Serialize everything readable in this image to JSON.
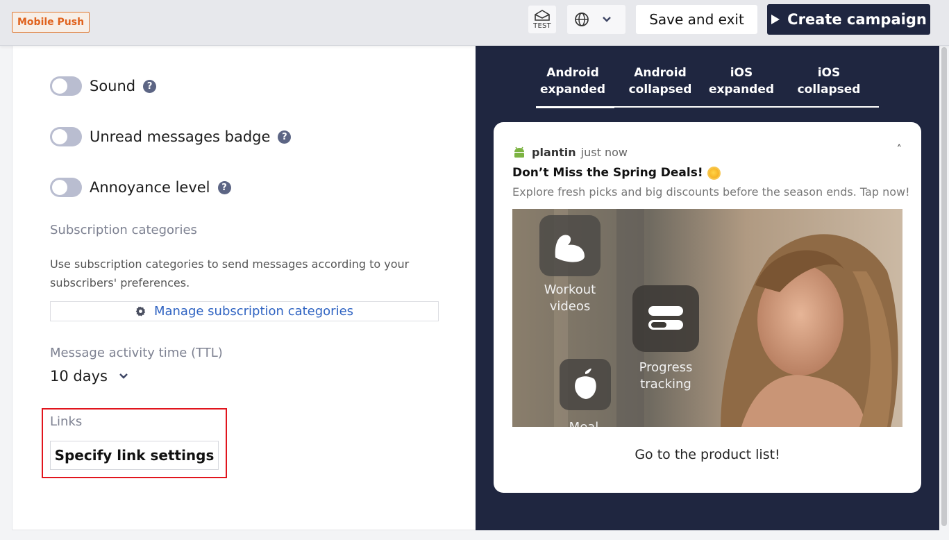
{
  "header": {
    "channel_badge": "Mobile Push",
    "test_label": "TEST",
    "save_label": "Save and exit",
    "create_label": "Create campaign"
  },
  "settings": {
    "toggles": [
      {
        "label": "Sound",
        "on": false
      },
      {
        "label": "Unread messages badge",
        "on": false
      },
      {
        "label": "Annoyance level",
        "on": false
      }
    ],
    "subscription_title": "Subscription categories",
    "subscription_desc": "Use subscription categories to send messages according to your subscribers' preferences.",
    "manage_label": "Manage subscription categories",
    "ttl_label": "Message activity time (TTL)",
    "ttl_value": "10 days",
    "links_label": "Links",
    "link_button": "Specify link settings"
  },
  "preview": {
    "tabs": [
      {
        "label": "Android expanded",
        "active": true
      },
      {
        "label": "Android collapsed",
        "active": false
      },
      {
        "label": "iOS expanded",
        "active": false
      },
      {
        "label": "iOS collapsed",
        "active": false
      }
    ],
    "app_name": "plantin",
    "time": "just now",
    "title": "Don’t Miss the Spring Deals!",
    "body": "Explore fresh picks and big discounts before the season ends. Tap now!",
    "image_labels": [
      "Workout videos",
      "Progress tracking",
      "Meal plans"
    ],
    "action_text": "Go to the product list!"
  },
  "colors": {
    "accent_dark": "#1f2640",
    "badge_orange": "#e0621d",
    "link_blue": "#2f63c2",
    "highlight_red": "#e1151d"
  }
}
